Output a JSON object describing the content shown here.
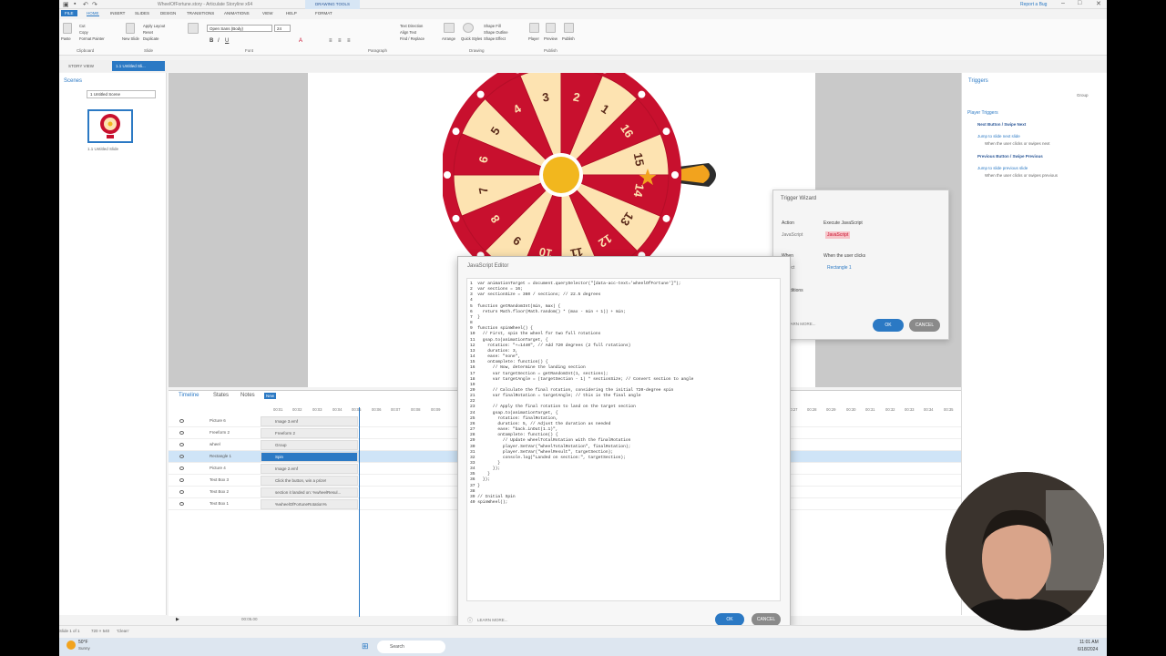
{
  "window": {
    "title": "WheelOfFortune.story - Articulate Storyline x64",
    "context_tab": "DRAWING TOOLS",
    "report_bug": "Report a Bug"
  },
  "ribbon_tabs": [
    "FILE",
    "HOME",
    "INSERT",
    "SLIDES",
    "DESIGN",
    "TRANSITIONS",
    "ANIMATIONS",
    "VIEW",
    "HELP",
    "FORMAT"
  ],
  "ribbon": {
    "paste": "Paste",
    "cut": "Cut",
    "copy": "Copy",
    "format_painter": "Format Painter",
    "new_slide": "New Slide",
    "apply_layout": "Apply Layout",
    "reset": "Reset",
    "duplicate": "Duplicate",
    "font": "Open Sans (Body)",
    "font_size": "24",
    "text_direction": "Text Direction",
    "align_text": "Align Text",
    "find_replace": "Find / Replace",
    "arrange": "Arrange",
    "quick_styles": "Quick Styles",
    "shape_fill": "Shape Fill",
    "shape_outline": "Shape Outline",
    "shape_effect": "Shape Effect",
    "player": "Player",
    "preview": "Preview",
    "publish": "Publish",
    "groups": [
      "Clipboard",
      "Slide",
      "Font",
      "Paragraph",
      "Drawing",
      "Publish"
    ]
  },
  "story_tabs": {
    "story_view": "STORY VIEW",
    "slide": "1.1 Untitled Sli..."
  },
  "scenes": {
    "title": "Scenes",
    "selected": "1 Untitled Scene",
    "thumb_label": "1.1 Untitled Slide"
  },
  "wheel": {
    "numbers": [
      "1",
      "2",
      "3",
      "4",
      "5",
      "6",
      "7",
      "8",
      "9",
      "10",
      "11",
      "12",
      "13",
      "14",
      "15",
      "16"
    ],
    "colors": {
      "red": "#c8102e",
      "cream": "#fde3b1",
      "hub": "#f2b71e",
      "pointer": "#f2a31e"
    }
  },
  "timeline": {
    "tabs": [
      "Timeline",
      "States",
      "Notes"
    ],
    "new_badge": "New",
    "ruler": [
      "00:01",
      "00:02",
      "00:03",
      "00:04",
      "00:05",
      "00:06",
      "00:07",
      "00:08",
      "00:09",
      "00:27",
      "00:28",
      "00:29",
      "00:30",
      "00:31",
      "00:32",
      "00:33",
      "00:34",
      "00:35"
    ],
    "rows": [
      {
        "name": "Picture 6",
        "bar": "Image 3.emf"
      },
      {
        "name": "Freeform 2",
        "bar": "Freeform 2"
      },
      {
        "name": "wheel",
        "bar": "Group"
      },
      {
        "name": "Rectangle 1",
        "bar": "Spin"
      },
      {
        "name": "Picture 4",
        "bar": "Image 2.emf"
      },
      {
        "name": "Text Box 3",
        "bar": "Click the button, win a prize!"
      },
      {
        "name": "Text Box 2",
        "bar": "section it landed on: %wheelResul..."
      },
      {
        "name": "Text Box 1",
        "bar": "%wheelOfFortuneRotation%"
      }
    ],
    "time_readout": "00:05.00"
  },
  "triggers": {
    "title": "Triggers",
    "group": "Group",
    "section": "Player Triggers",
    "items": [
      {
        "header": "Next Button / Swipe Next",
        "action": "Jump to slide next slide",
        "when": "When the user clicks or swipes next"
      },
      {
        "header": "Previous Button / Swipe Previous",
        "action": "Jump to slide previous slide",
        "when": "When the user clicks or swipes previous"
      }
    ]
  },
  "wizard": {
    "title": "Trigger Wizard",
    "action_label": "Action",
    "action_value": "Execute JavaScript",
    "js_label": "JavaScript",
    "js_value": "JavaScript",
    "when_label": "When",
    "when_value": "When the user clicks",
    "object_label": "Object",
    "object_value": "Rectangle 1",
    "conditions_label": "Conditions",
    "learn_more": "LEARN MORE...",
    "ok": "OK",
    "cancel": "CANCEL"
  },
  "js_editor": {
    "title": "JavaScript Editor",
    "code": "1  var animationTarget = document.querySelector(\"[data-acc-text='wheelOfFortune']\");\n2  var sections = 16;\n3  var sectionSize = 360 / sections; // 22.5 degrees\n4\n5  function getRandomInt(min, max) {\n6    return Math.floor(Math.random() * (max - min + 1)) + min;\n7  }\n8\n9  function spinWheel() {\n10   // First, spin the wheel for two full rotations\n11   gsap.to(animationTarget, {\n12     rotation: \"+=1440\", // Add 720 degrees (2 full rotations)\n13     duration: 3,\n14     ease: \"none\",\n15     onComplete: function() {\n16       // Now, determine the landing section\n17       var targetSection = getRandomInt(1, sections);\n18       var targetAngle = (targetSection - 1) * sectionSize; // Convert section to angle\n19\n20       // Calculate the final rotation, considering the initial 720-degree spin\n21       var finalRotation = targetAngle; // this is the final angle\n22\n23       // Apply the final rotation to land on the target section\n24       gsap.to(animationTarget, {\n25         rotation: finalRotation,\n26         duration: 5, // Adjust the duration as needed\n27         ease: \"back.inOut(1.1)\",\n28         onComplete: function() {\n29           // Update wheelTotalRotation with the finalRotation\n30           player.SetVar(\"wheelTotalRotation\", finalRotation);\n31           player.SetVar(\"wheelResult\", targetSection);\n32           console.log(\"Landed on section:\", targetSection);\n33         }\n34       });\n35     }\n36   });\n37 }\n38\n39 // Initial Spin\n40 spinWheel();",
    "learn_more": "LEARN MORE...",
    "ok": "OK",
    "cancel": "CANCEL"
  },
  "statusbar": {
    "slide": "Slide 1 of 1",
    "size": "720 × 540",
    "theme": "'Clean'"
  },
  "taskbar": {
    "weather_temp": "50°F",
    "weather_text": "Sunny",
    "search": "Search",
    "time": "11:01 AM",
    "date": "6/18/2024"
  }
}
